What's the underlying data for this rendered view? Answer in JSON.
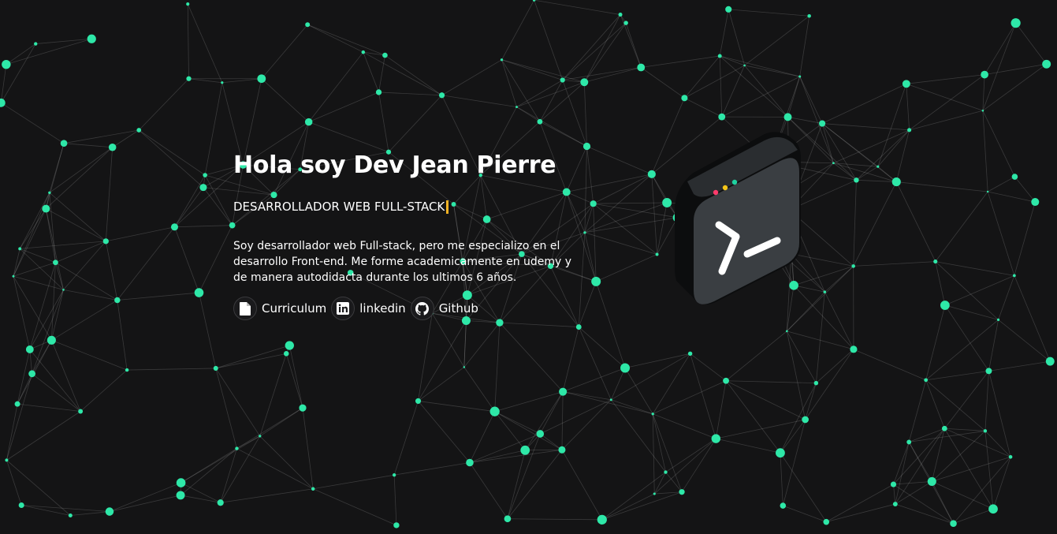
{
  "hero": {
    "title": "Hola soy Dev Jean Pierre",
    "subtitle": "DESARROLLADOR WEB FULL-STACK",
    "about": "Soy desarrollador web Full-stack, pero me especializo en el desarrollo Front-end. Me forme academicamente en udemy y de manera autodidacta durante los ultimos 6 años."
  },
  "links": [
    {
      "label": "Curriculum",
      "icon": "document-icon"
    },
    {
      "label": "linkedin",
      "icon": "linkedin-icon"
    },
    {
      "label": "Github",
      "icon": "github-icon"
    }
  ],
  "colors": {
    "background": "#141415",
    "node": "#2ee8a8",
    "caret": "#f5b324",
    "dot_red": "#ff3b6b",
    "dot_yellow": "#f5c518",
    "dot_green": "#1fd1a0"
  },
  "art": {
    "icon": "terminal-icon"
  }
}
